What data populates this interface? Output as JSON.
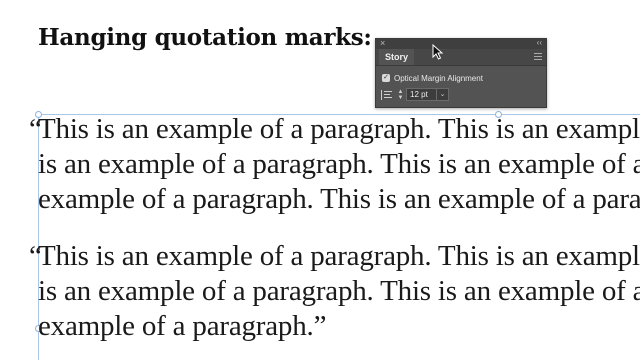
{
  "heading": "Hanging quotation marks:",
  "paragraph1": {
    "open_quote": "“",
    "lines": [
      "This is an example of a paragraph. This is an example of a paragraph. This",
      "is an example of a paragraph. This is an example of a paragraph. This is an",
      "example of a paragraph. This is an example of a paragraph. This is an"
    ]
  },
  "paragraph2": {
    "open_quote": "“",
    "lines": [
      "This is an example of a paragraph. This is an example of a paragraph. This",
      "is an example of a paragraph. This is an example of a paragraph. This is an",
      "example of a paragraph.”"
    ]
  },
  "story_panel": {
    "close_glyph": "×",
    "collapse_glyph": "‹‹",
    "tab_label": "Story",
    "optical_margin_alignment": {
      "label": "Optical Margin Alignment",
      "checked": true,
      "check_glyph": "✓"
    },
    "size_value": "12 pt",
    "stepper_up": "▲",
    "stepper_down": "▼",
    "dropdown_glyph": "⌄"
  },
  "colors": {
    "panel_bg": "#535353",
    "frame_guide": "#a9c6e8",
    "text": "#1a1a1a"
  }
}
